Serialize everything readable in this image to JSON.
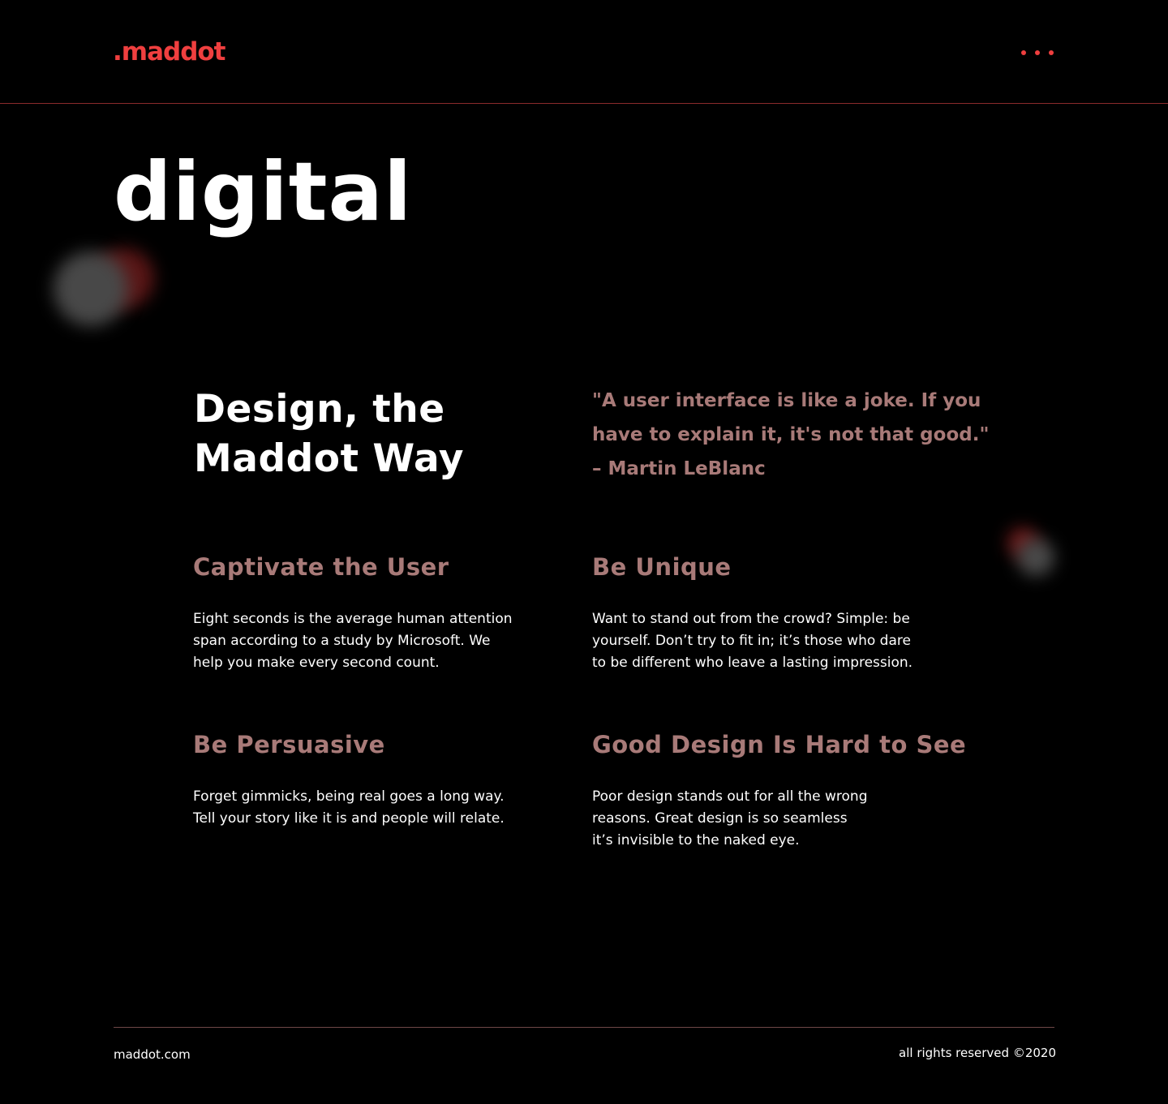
{
  "header": {
    "logo": ".maddot",
    "menu_icon": "more-dots-icon"
  },
  "hero": {
    "title": "digital"
  },
  "section": {
    "title": "Design, the Maddot Way"
  },
  "quote": {
    "text": "\"A user interface is like a joke. If you have to explain it, it's not that good.\"",
    "author": "– Martin LeBlanc"
  },
  "features": [
    {
      "title": "Captivate the User",
      "body": "Eight seconds is the average human attention span according to a study by Microsoft. We help you make every second count."
    },
    {
      "title": "Be Unique",
      "body": "Want to stand out from the crowd? Simple: be yourself.  Don’t try to fit in; it’s those who dare to be different who leave a lasting impression."
    },
    {
      "title": "Be Persuasive",
      "body": "Forget gimmicks, being real goes a long way. Tell your story like it is and people will relate."
    },
    {
      "title": "Good Design Is Hard to See",
      "body": "Poor design stands out for all the wrong reasons. Great design is so seamless it’s invisible to the naked eye."
    }
  ],
  "footer": {
    "site": "maddot.com",
    "copyright": "all rights reserved ©2020"
  },
  "colors": {
    "background": "#000000",
    "accent": "#ef3f3f",
    "muted_rose": "#a87a78",
    "text": "#ffffff"
  }
}
